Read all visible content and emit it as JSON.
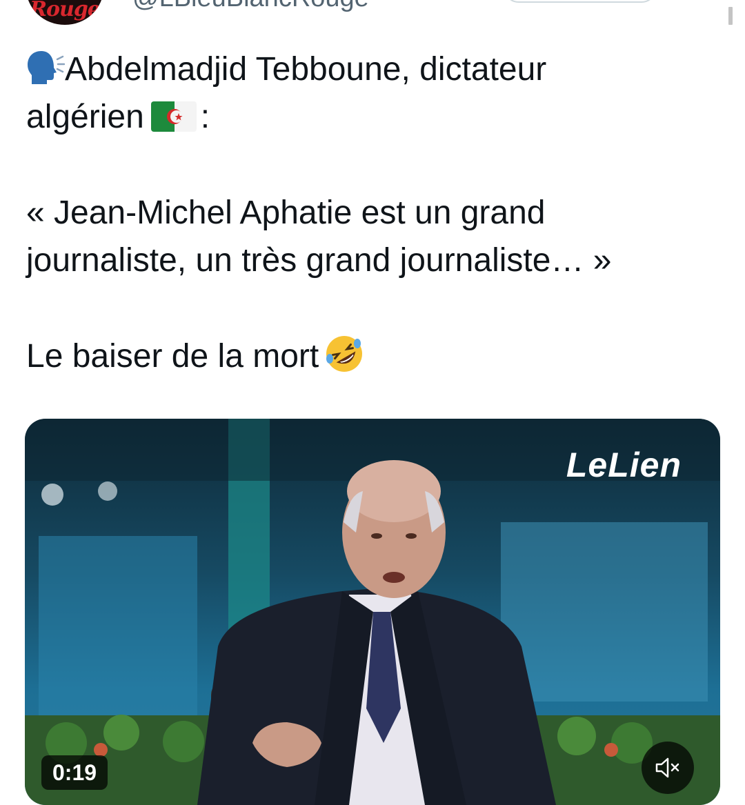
{
  "header": {
    "avatar_text": "Rouge",
    "handle": "@LBleuBlancRouge"
  },
  "tweet": {
    "line1": "Abdelmadjid Tebboune, dictateur",
    "line2_prefix": "algérien",
    "line2_suffix": ":",
    "line3": "« Jean-Michel Aphatie est un grand",
    "line4": "journaliste, un très grand journaliste… »",
    "line5": "Le baiser de la mort",
    "icons": [
      "speaking-head-icon",
      "algeria-flag-icon",
      "rolling-laughing-icon"
    ]
  },
  "video": {
    "watermark": "LeLien",
    "duration": "0:19",
    "mute_icon": "speaker-muted-icon"
  }
}
